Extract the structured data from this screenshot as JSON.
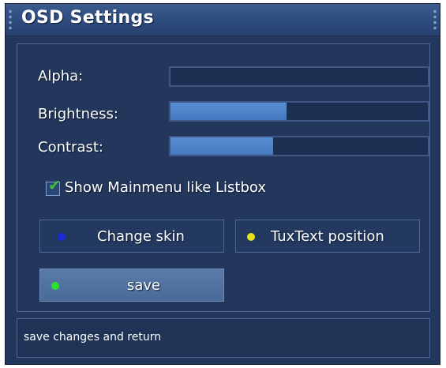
{
  "window": {
    "title": "OSD Settings"
  },
  "settings": {
    "sliders": [
      {
        "label": "Alpha:",
        "level": 0.0
      },
      {
        "label": "Brightness:",
        "level": 0.45
      },
      {
        "label": "Contrast:",
        "level": 0.4
      }
    ],
    "checkbox": {
      "label": "Show Mainmenu like Listbox",
      "checked": true
    }
  },
  "buttons": {
    "change_skin": {
      "label": "Change skin",
      "dot_color": "#1a2bd8"
    },
    "tuxtext_position": {
      "label": "TuxText position",
      "dot_color": "#e8e01a"
    },
    "save": {
      "label": "save",
      "dot_color": "#2ee02e"
    }
  },
  "status": {
    "text": "save changes and return"
  },
  "colors": {
    "background": "#22375b",
    "slider_fill": "#4f86cc",
    "check": "#3fbf3f"
  }
}
